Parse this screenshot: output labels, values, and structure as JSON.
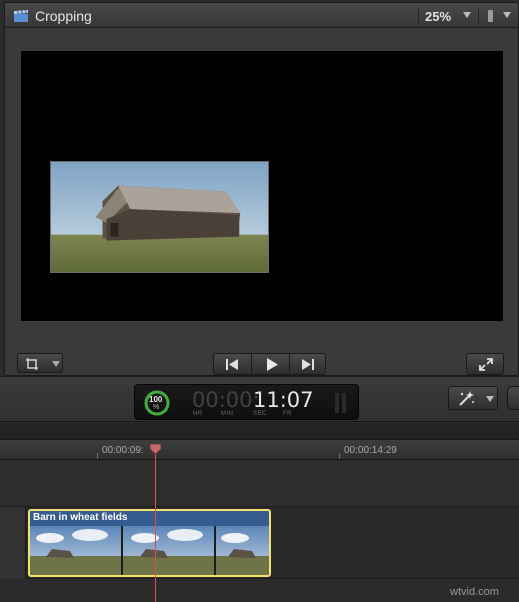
{
  "viewer": {
    "title": "Cropping",
    "zoom": "25%",
    "icons": {
      "clapper": "clapper-icon",
      "visibility": "view-options-icon"
    }
  },
  "transport": {
    "prev": "previous-edit-icon",
    "play": "play-icon",
    "next": "next-edit-icon",
    "transform": "transform-crop-icon",
    "fullscreen": "fullscreen-icon"
  },
  "dashboard": {
    "percent": "100",
    "percent_sign": "%",
    "tc_dim": "00:00:",
    "tc_lit": "11:07",
    "labels": [
      "HR",
      "MIN",
      "SEC",
      "FR"
    ]
  },
  "ruler": {
    "marks": [
      "00:00:09:",
      "00:00:14:29"
    ]
  },
  "clip": {
    "title": "Barn in wheat fields",
    "thumb_count": 3,
    "border_color": "#f1e26a",
    "body_color": "#3f5e8a"
  },
  "playhead_color": "#e44b4b",
  "watermark": "wtvid.com"
}
